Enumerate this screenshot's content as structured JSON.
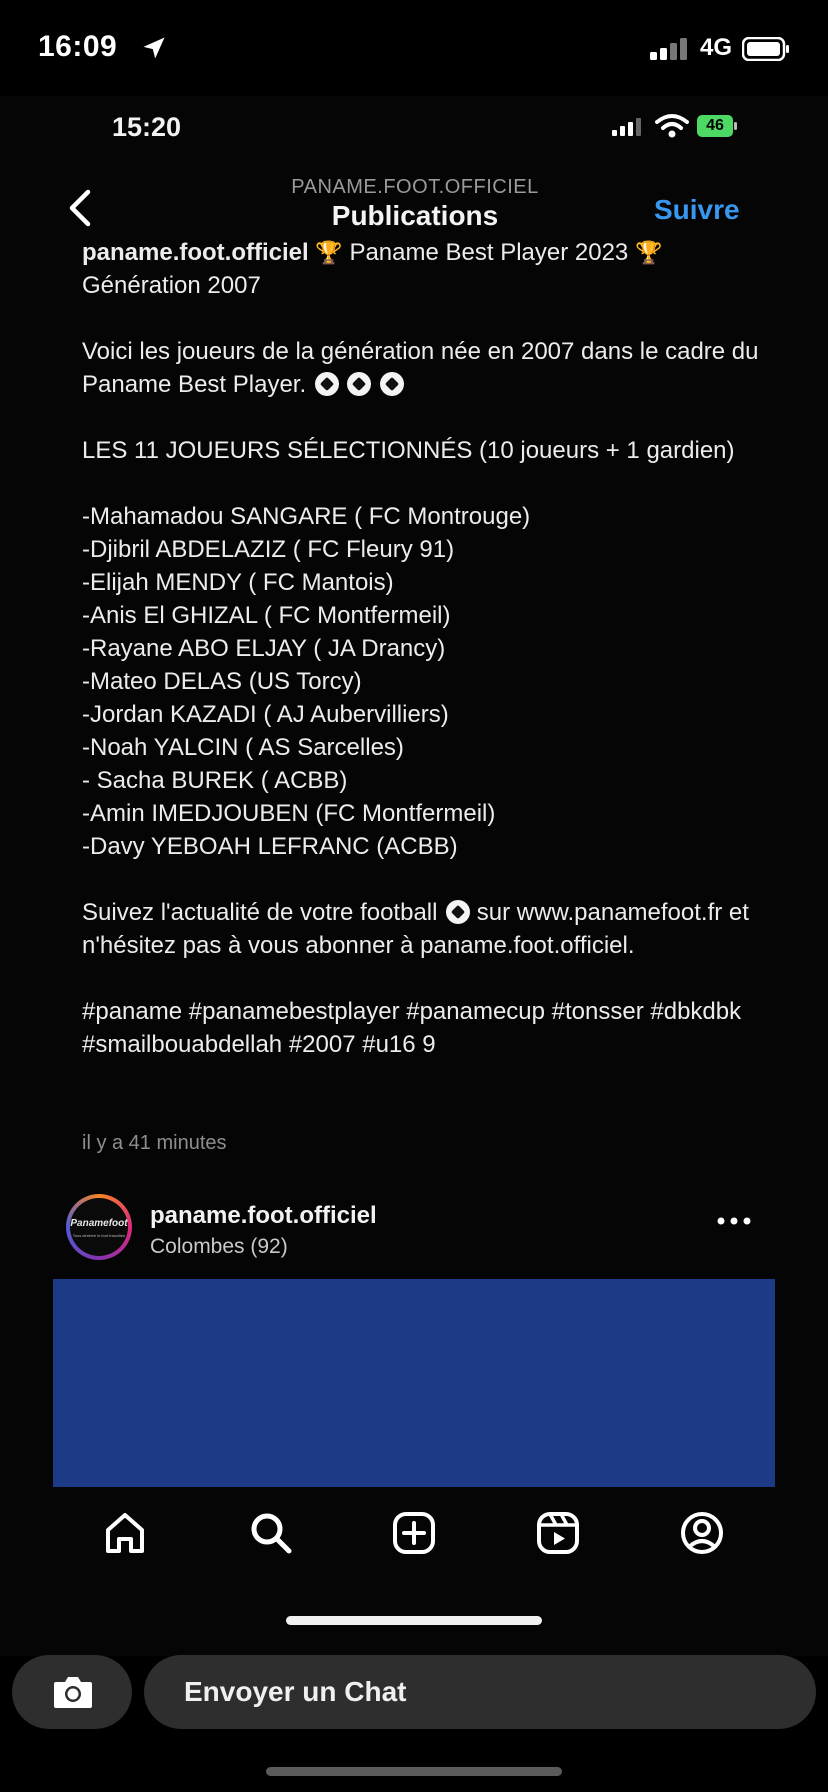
{
  "outer_status": {
    "time": "16:09",
    "network": "4G"
  },
  "inner_status": {
    "time": "15:20",
    "battery": "46"
  },
  "header": {
    "subtitle": "PANAME.FOOT.OFFICIEL",
    "title": "Publications",
    "follow_label": "Suivre"
  },
  "caption": {
    "username": "paname.foot.officiel",
    "line1_text": "Paname Best Player 2023",
    "line2": "Génération 2007",
    "intro": "Voici les joueurs de la génération née en 2007 dans le cadre du Paname Best Player.",
    "selection_title": "LES 11 JOUEURS SÉLECTIONNÉS (10 joueurs + 1 gardien)",
    "players": [
      "-Mahamadou SANGARE ( FC Montrouge)",
      "-Djibril ABDELAZIZ ( FC Fleury 91)",
      "-Elijah MENDY ( FC Mantois)",
      "-Anis El GHIZAL ( FC Montfermeil)",
      "-Rayane ABO ELJAY ( JA Drancy)",
      "-Mateo DELAS (US Torcy)",
      "-Jordan KAZADI ( AJ Aubervilliers)",
      "-Noah YALCIN ( AS Sarcelles)",
      "- Sacha BUREK ( ACBB)",
      "-Amin IMEDJOUBEN (FC Montfermeil)",
      "-Davy YEBOAH LEFRANC (ACBB)"
    ],
    "cta_before": "Suivez l'actualité de votre football",
    "cta_after": "sur www.panamefoot.fr et n'hésitez pas à vous abonner à paname.foot.officiel.",
    "hashtags": "#paname #panamebestplayer #panamecup #tonsser #dbkdbk #smailbouabdellah  #2007 #u16 9"
  },
  "timestamp": "il y a 41 minutes",
  "next_post": {
    "avatar_text": "Panamefoot",
    "avatar_sub": "Tous derrière le foot francilien",
    "username": "paname.foot.officiel",
    "location": "Colombes (92)"
  },
  "chat_bar": {
    "placeholder": "Envoyer un Chat"
  },
  "icons": [
    "location-arrow-icon",
    "signal-icon",
    "battery-icon",
    "wifi-icon",
    "back-chevron-icon",
    "trophy-icon",
    "soccer-ball-icon",
    "more-icon",
    "home-icon",
    "search-icon",
    "create-icon",
    "reels-icon",
    "profile-icon",
    "camera-icon"
  ],
  "colors": {
    "background": "#000000",
    "accent": "#3897f0",
    "post_image": "#1d3a86",
    "battery_green": "#4cd964"
  }
}
